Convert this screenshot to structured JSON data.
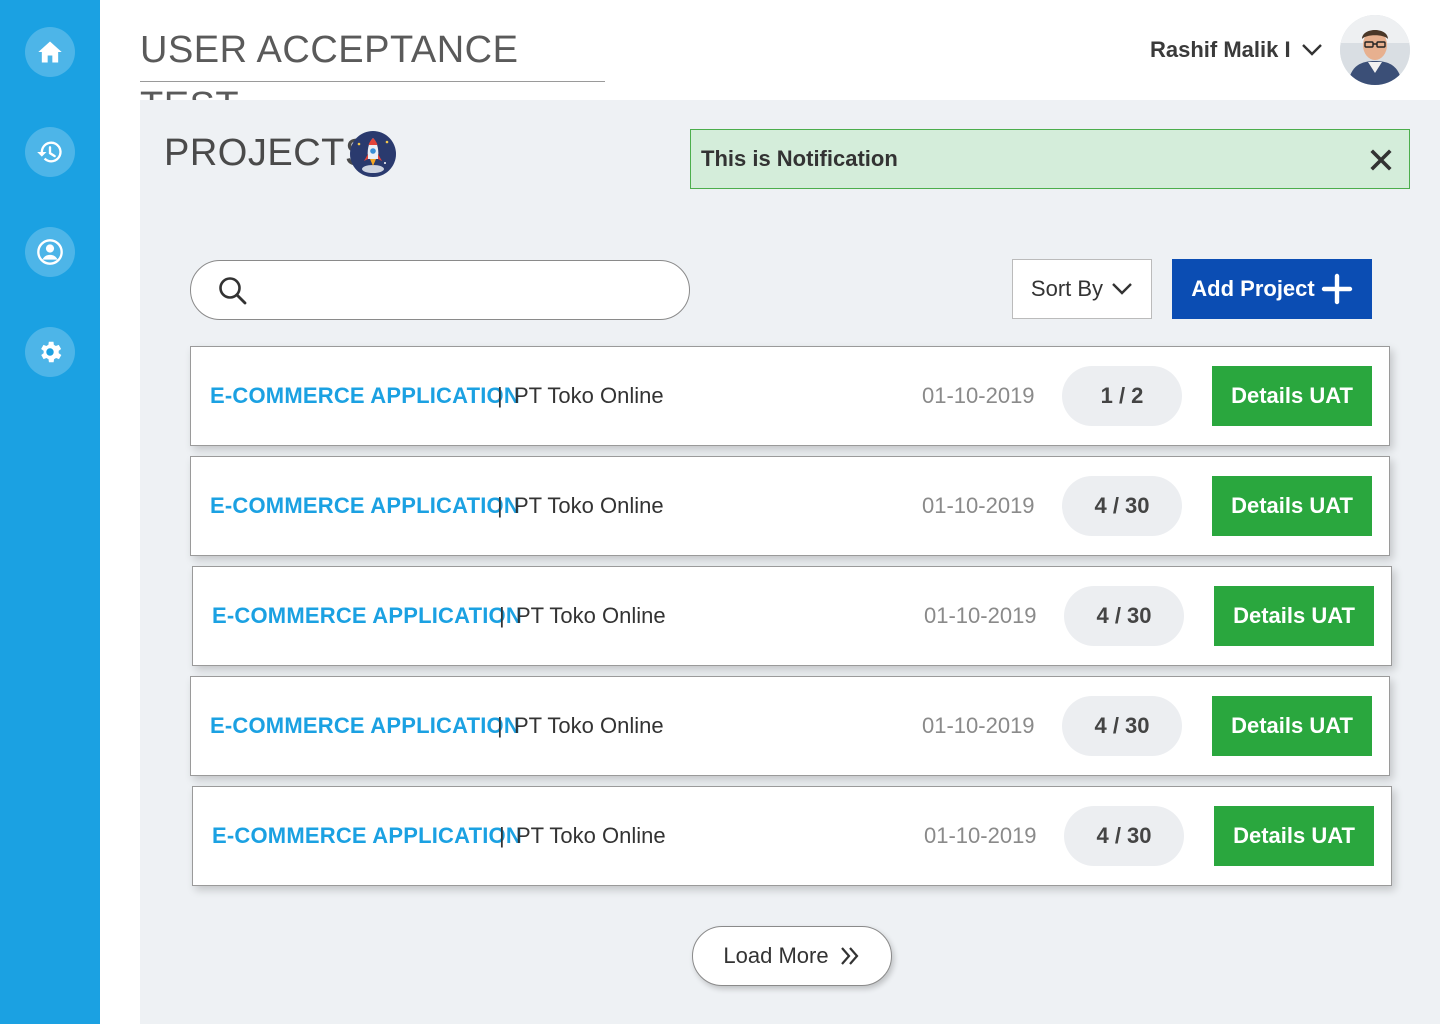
{
  "header": {
    "app_title": "USER ACCEPTANCE TEST",
    "user_name": "Rashif Malik I"
  },
  "sidebar": {
    "items": [
      {
        "icon": "home-icon"
      },
      {
        "icon": "history-icon"
      },
      {
        "icon": "user-icon"
      },
      {
        "icon": "gear-icon"
      }
    ]
  },
  "page": {
    "title": "PROJECTS",
    "notification": "This is Notification"
  },
  "toolbar": {
    "search_placeholder": "",
    "sort_label": "Sort By",
    "add_label": "Add Project"
  },
  "projects": [
    {
      "name": "E-COMMERCE APPLICATION",
      "client": "PT Toko Online",
      "date": "01-10-2019",
      "progress": "1 / 2",
      "action": "Details UAT"
    },
    {
      "name": "E-COMMERCE APPLICATION",
      "client": "PT Toko Online",
      "date": "01-10-2019",
      "progress": "4 / 30",
      "action": "Details UAT"
    },
    {
      "name": "E-COMMERCE APPLICATION",
      "client": "PT Toko Online",
      "date": "01-10-2019",
      "progress": "4 / 30",
      "action": "Details UAT"
    },
    {
      "name": "E-COMMERCE APPLICATION",
      "client": "PT Toko Online",
      "date": "01-10-2019",
      "progress": "4 / 30",
      "action": "Details UAT"
    },
    {
      "name": "E-COMMERCE APPLICATION",
      "client": "PT Toko Online",
      "date": "01-10-2019",
      "progress": "4 / 30",
      "action": "Details UAT"
    }
  ],
  "separator": "|",
  "load_more_label": "Load More",
  "colors": {
    "sidebar": "#1ba1e2",
    "primary": "#0b4db3",
    "success": "#2aa73e",
    "project_name": "#1ba1e2",
    "notification_bg": "#d4edda"
  }
}
